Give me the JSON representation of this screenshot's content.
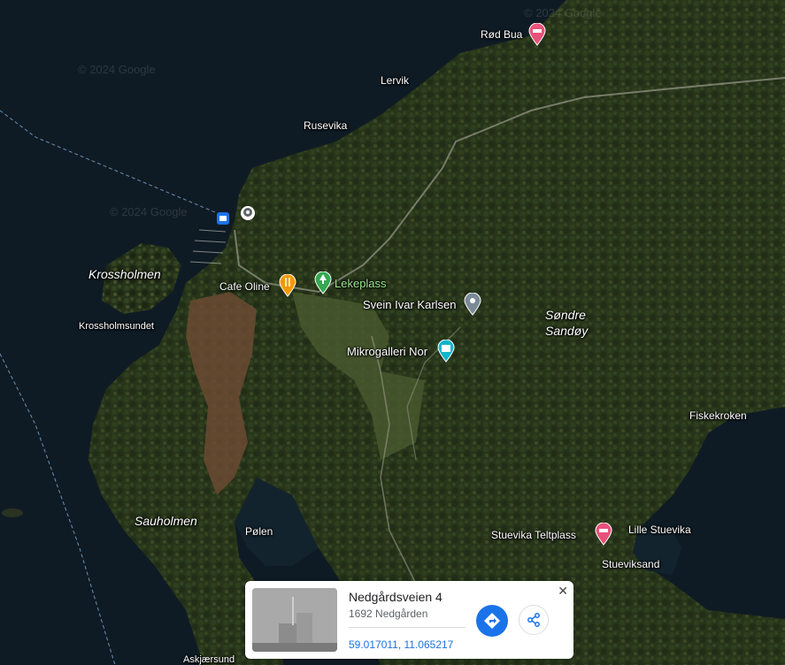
{
  "watermarks": [
    "© 2024 Google",
    "© 2024 Google",
    "© 2024 Google"
  ],
  "places": {
    "rod_bua": "Rød Bua",
    "lervik": "Lervik",
    "rusevika": "Rusevika",
    "krossholmen": "Krossholmen",
    "cafe_oline": "Cafe Oline",
    "lekeplass": "Lekeplass",
    "svein_ivar": "Svein Ivar Karlsen",
    "sondre_sandoy": "Søndre\nSandøy",
    "krossholmsundet": "Krossholmsundet",
    "mikrogalleri": "Mikrogalleri Nor",
    "fiskekroken": "Fiskekroken",
    "sauholmen": "Sauholmen",
    "polen": "Pølen",
    "stuevika_teltplass": "Stuevika Teltplass",
    "lille_stuevika": "Lille Stuevika",
    "stueviksand": "Stueviksand",
    "askjaersund": "Askjærsund"
  },
  "card": {
    "title": "Nedgårdsveien 4",
    "subtitle": "1692 Nedgården",
    "coords": "59.017011, 11.065217",
    "close": "✕"
  },
  "icons": {
    "directions": "directions-icon",
    "share": "share-icon"
  },
  "colors": {
    "hotel_pin": "#e8517a",
    "food_pin": "#f29900",
    "park_pin": "#34a853",
    "museum_pin": "#12b5cb",
    "generic_pin": "#7b8a97",
    "card_accent": "#1a73e8"
  }
}
